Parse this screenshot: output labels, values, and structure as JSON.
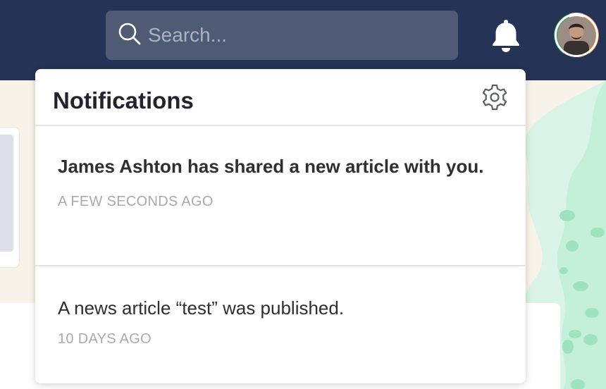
{
  "header": {
    "search_placeholder": "Search...",
    "search_value": ""
  },
  "notifications": {
    "title": "Notifications",
    "items": [
      {
        "text": "James Ashton has shared a new article with you.",
        "time": "A FEW SECONDS AGO",
        "unread": true
      },
      {
        "text": "A news article “test” was published.",
        "time": "10 DAYS AGO",
        "unread": false
      }
    ]
  },
  "icons": {
    "search": "search-icon",
    "bell": "bell-icon",
    "settings": "gear-icon",
    "avatar": "user-avatar"
  },
  "colors": {
    "header_bg": "#243356",
    "search_bg": "#4f5b74",
    "panel_bg": "#ffffff",
    "title_text": "#23232b",
    "muted_text": "#a9a9b0",
    "accent_green": "#a6e9c8"
  }
}
